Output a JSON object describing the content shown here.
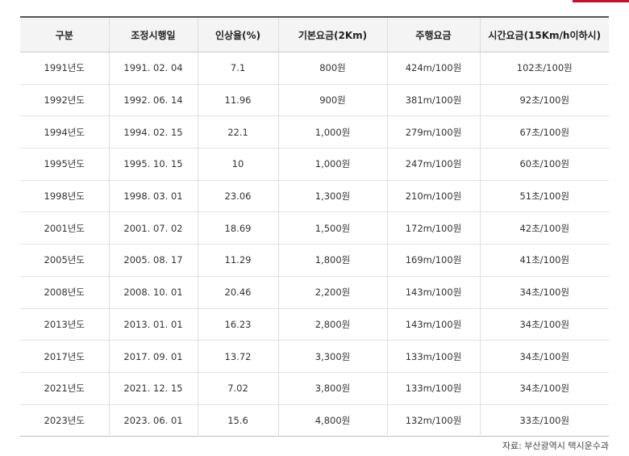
{
  "header": {
    "columns": [
      "구분",
      "조정시행일",
      "인상율(%)",
      "기본요금(2Km)",
      "주행요금",
      "시간요금(15Km/h이하시)"
    ]
  },
  "rows": [
    [
      "1991년도",
      "1991. 02. 04",
      "7.1",
      "800원",
      "424m/100원",
      "102초/100원"
    ],
    [
      "1992년도",
      "1992. 06. 14",
      "11.96",
      "900원",
      "381m/100원",
      "92초/100원"
    ],
    [
      "1994년도",
      "1994. 02. 15",
      "22.1",
      "1,000원",
      "279m/100원",
      "67초/100원"
    ],
    [
      "1995년도",
      "1995. 10. 15",
      "10",
      "1,000원",
      "247m/100원",
      "60초/100원"
    ],
    [
      "1998년도",
      "1998. 03. 01",
      "23.06",
      "1,300원",
      "210m/100원",
      "51초/100원"
    ],
    [
      "2001년도",
      "2001. 07. 02",
      "18.69",
      "1,500원",
      "172m/100원",
      "42초/100원"
    ],
    [
      "2005년도",
      "2005. 08. 17",
      "11.29",
      "1,800원",
      "169m/100원",
      "41초/100원"
    ],
    [
      "2008년도",
      "2008. 10. 01",
      "20.46",
      "2,200원",
      "143m/100원",
      "34초/100원"
    ],
    [
      "2013년도",
      "2013. 01. 01",
      "16.23",
      "2,800원",
      "143m/100원",
      "34초/100원"
    ],
    [
      "2017년도",
      "2017. 09. 01",
      "13.72",
      "3,300원",
      "133m/100원",
      "34초/100원"
    ],
    [
      "2021년도",
      "2021. 12. 15",
      "7.02",
      "3,800원",
      "133m/100원",
      "34초/100원"
    ],
    [
      "2023년도",
      "2023. 06. 01",
      "15.6",
      "4,800원",
      "132m/100원",
      "33초/100원"
    ]
  ],
  "source": "자료: 부산광역시 택시운수과",
  "colors": {
    "accent": "#c8102e",
    "header_bg": "#f4f4f4"
  }
}
